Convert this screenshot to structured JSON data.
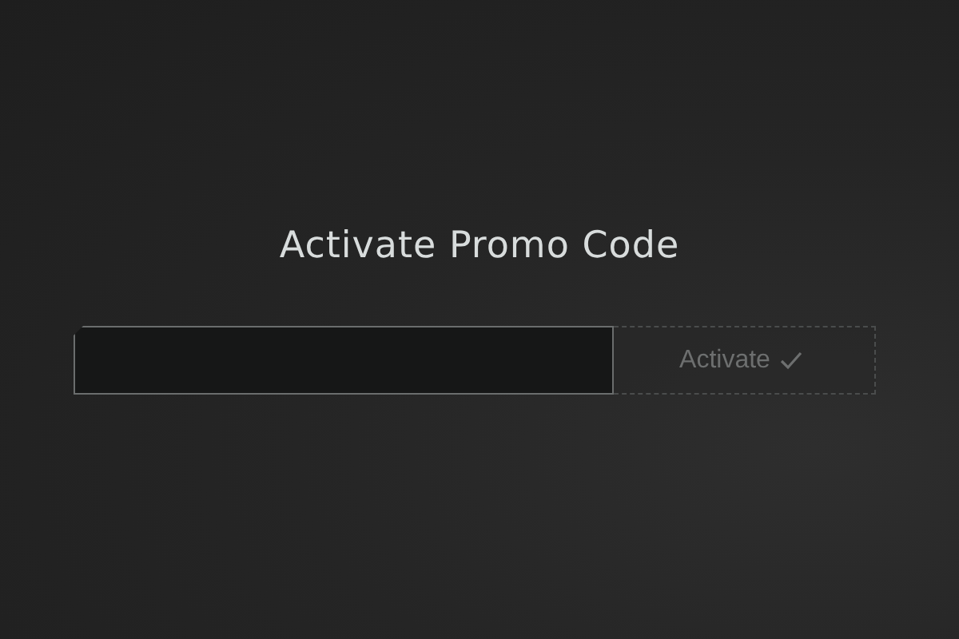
{
  "title": "Activate Promo Code",
  "activate_button": {
    "label": "Activate",
    "disabled": true
  }
}
